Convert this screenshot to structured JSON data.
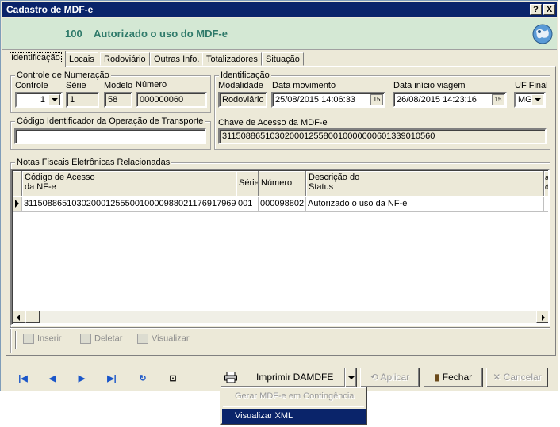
{
  "window": {
    "title": "Cadastro de MDF-e",
    "help_btn": "?",
    "close_btn": "X"
  },
  "status": {
    "code": "100",
    "message": "Autorizado o uso do MDF-e"
  },
  "tabs": [
    {
      "label": "Identificação",
      "active": true
    },
    {
      "label": "Locais"
    },
    {
      "label": "Rodoviário"
    },
    {
      "label": "Outras Info."
    },
    {
      "label": "Totalizadores"
    },
    {
      "label": "Situação"
    }
  ],
  "numeracao": {
    "group_title": "Controle de Numeração",
    "controle_label": "Controle",
    "controle_value": "1",
    "serie_label": "Série",
    "serie_value": "1",
    "modelo_label": "Modelo",
    "modelo_value": "58",
    "numero_label": "Número",
    "numero_value": "000000060"
  },
  "identificacao": {
    "group_title": "Identificação",
    "modalidade_label": "Modalidade",
    "modalidade_value": "Rodoviário",
    "data_mov_label": "Data movimento",
    "data_mov_value": "25/08/2015 14:06:33",
    "data_inicio_label": "Data início viagem",
    "data_inicio_value": "26/08/2015 14:23:16",
    "uf_label": "UF Final",
    "uf_value": "MG",
    "chave_label": "Chave de Acesso da MDF-e",
    "chave_value": "31150886510302000125580010000000601339010560",
    "cal_icon_text": "15"
  },
  "transporte": {
    "group_title": "Código Identificador da Operação de Transporte",
    "value": ""
  },
  "notas": {
    "group_title": "Notas Fiscais Eletrônicas Relacionadas",
    "columns": [
      "Código de Acesso\nda NF-e",
      "Série",
      "Número",
      "Descrição do\nStatus",
      "a\nd"
    ],
    "rows": [
      [
        "31150886510302000125550010000988021176917969",
        "001",
        "000098802",
        "Autorizado o uso da NF-e"
      ]
    ]
  },
  "grid_toolbar": {
    "inserir": "Inserir",
    "deletar": "Deletar",
    "visualizar": "Visualizar"
  },
  "buttons": {
    "imprimir": "Imprimir DAMDFE",
    "aplicar": "Aplicar",
    "fechar": "Fechar",
    "cancelar": "Cancelar"
  },
  "menu": {
    "item1": "Gerar MDF-e em Contingência",
    "item2": "Visualizar XML"
  }
}
